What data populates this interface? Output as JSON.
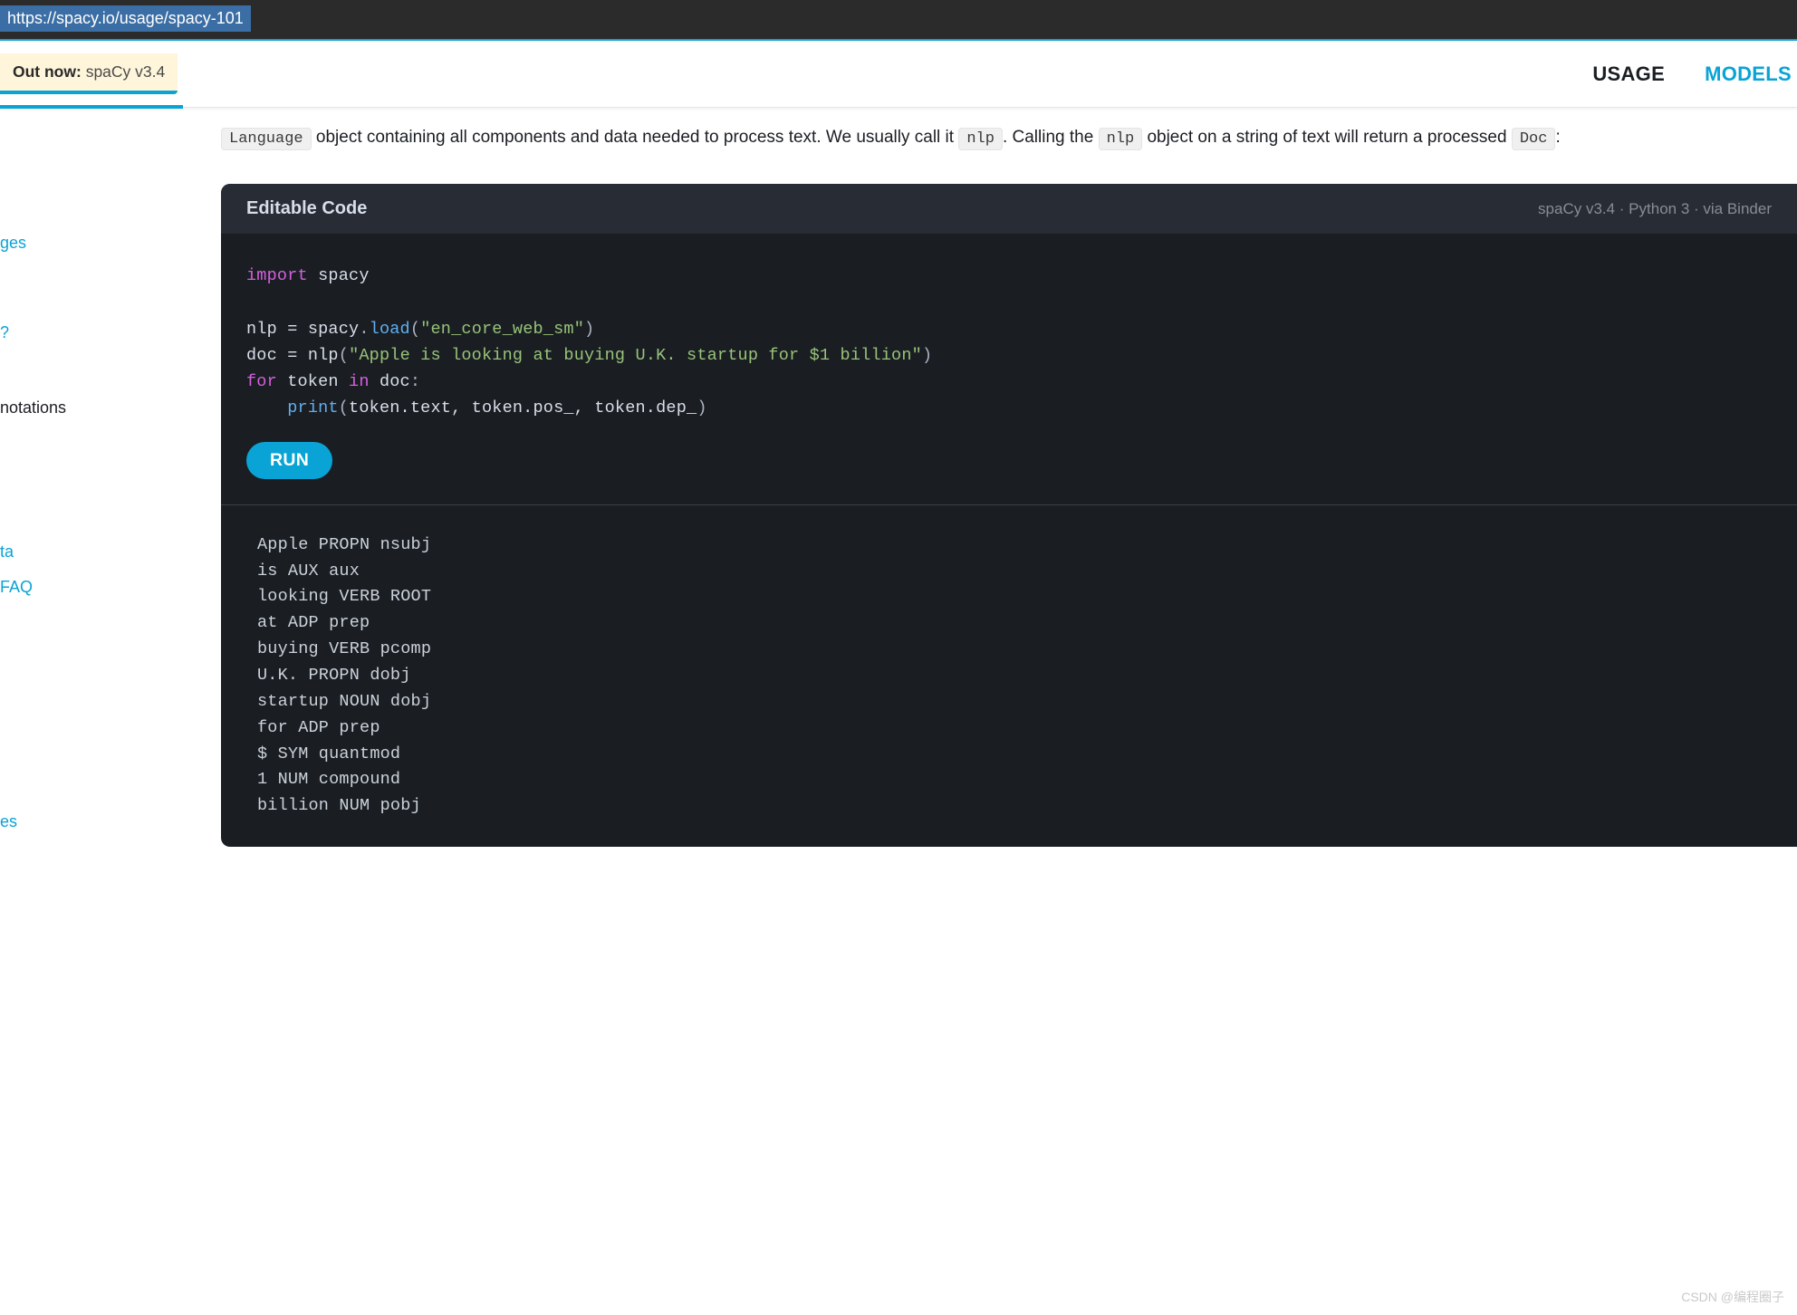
{
  "url": "https://spacy.io/usage/spacy-101",
  "banner": {
    "prefix": "Out now:",
    "link": "spaCy v3.4"
  },
  "nav": {
    "usage": "USAGE",
    "models": "MODELS"
  },
  "sidebar": {
    "items": [
      "ges",
      "?",
      "notations",
      "ta",
      "FAQ",
      "es"
    ]
  },
  "intro": {
    "code1": "Language",
    "text1": " object containing all components and data needed to process text. We usually call it ",
    "code2": "nlp",
    "text2": ". Calling the ",
    "code3": "nlp",
    "text3": " object on a string of text will return a processed ",
    "code4": "Doc",
    "text4": ":"
  },
  "code_block": {
    "title": "Editable Code",
    "meta": "spaCy v3.4 · Python 3 · via Binder",
    "run_label": "RUN",
    "code": {
      "line1": {
        "kw": "import",
        "id": " spacy"
      },
      "line2": {
        "p1": "nlp ",
        "op1": "=",
        "p2": " spacy",
        "punc1": ".",
        "fn": "load",
        "punc2": "(",
        "str": "\"en_core_web_sm\"",
        "punc3": ")"
      },
      "line3": {
        "p1": "doc ",
        "op1": "=",
        "p2": " nlp",
        "punc1": "(",
        "str": "\"Apple is looking at buying U.K. startup for $1 billion\"",
        "punc2": ")"
      },
      "line4": {
        "kw1": "for",
        "p1": " token ",
        "kw2": "in",
        "p2": " doc",
        "punc": ":"
      },
      "line5": {
        "indent": "    ",
        "fn": "print",
        "punc1": "(",
        "args": "token.text, token.pos_, token.dep_",
        "punc2": ")"
      }
    }
  },
  "output": {
    "lines": [
      "Apple PROPN nsubj",
      "is AUX aux",
      "looking VERB ROOT",
      "at ADP prep",
      "buying VERB pcomp",
      "U.K. PROPN dobj",
      "startup NOUN dobj",
      "for ADP prep",
      "$ SYM quantmod",
      "1 NUM compound",
      "billion NUM pobj"
    ]
  },
  "watermark": "CSDN @编程圈子"
}
